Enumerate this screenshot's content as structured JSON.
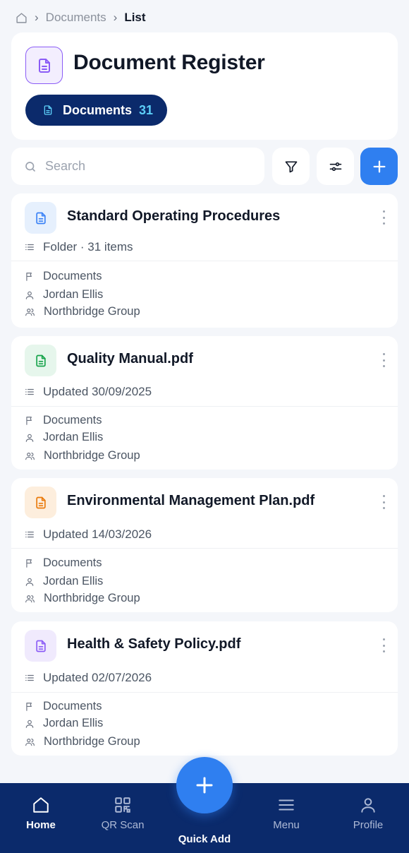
{
  "breadcrumb": {
    "items": [
      "Documents",
      "List"
    ]
  },
  "header": {
    "title": "Document Register",
    "pill_label": "Documents",
    "pill_count": "31"
  },
  "search": {
    "placeholder": "Search",
    "value": ""
  },
  "documents": [
    {
      "title": "Standard Operating Procedures",
      "subline": "Folder · 31 items",
      "category": "Documents",
      "owner": "Jordan Ellis",
      "group": "Northbridge Group",
      "icon": "folder-file-icon",
      "icon_color": "#3b82f6",
      "icon_bg": "#e6f0fd"
    },
    {
      "title": "Quality Manual.pdf",
      "subline": "Updated 30/09/2025",
      "category": "Documents",
      "owner": "Jordan Ellis",
      "group": "Northbridge Group",
      "icon": "file-text-icon",
      "icon_color": "#16a34a",
      "icon_bg": "#e6f6ec"
    },
    {
      "title": "Environmental Management Plan.pdf",
      "subline": "Updated 14/03/2026",
      "category": "Documents",
      "owner": "Jordan Ellis",
      "group": "Northbridge Group",
      "icon": "file-text-icon",
      "icon_color": "#ea7a0b",
      "icon_bg": "#fdeedd"
    },
    {
      "title": "Health & Safety Policy.pdf",
      "subline": "Updated 02/07/2026",
      "category": "Documents",
      "owner": "Jordan Ellis",
      "group": "Northbridge Group",
      "icon": "file-text-icon",
      "icon_color": "#8b5cf6",
      "icon_bg": "#f0eafd"
    }
  ],
  "bottom_nav": {
    "items": [
      {
        "label": "Home",
        "icon": "home-icon",
        "active": true
      },
      {
        "label": "QR Scan",
        "icon": "qr-code-icon",
        "active": false
      },
      {
        "label": "Menu",
        "icon": "menu-icon",
        "active": false
      },
      {
        "label": "Profile",
        "icon": "user-icon",
        "active": false
      }
    ],
    "quick_add_label": "Quick Add"
  },
  "colors": {
    "accent": "#2f7ff0",
    "nav_background": "#0b2a6b",
    "pill_count": "#5ccdf7",
    "header_icon": "#8b5cf6"
  }
}
